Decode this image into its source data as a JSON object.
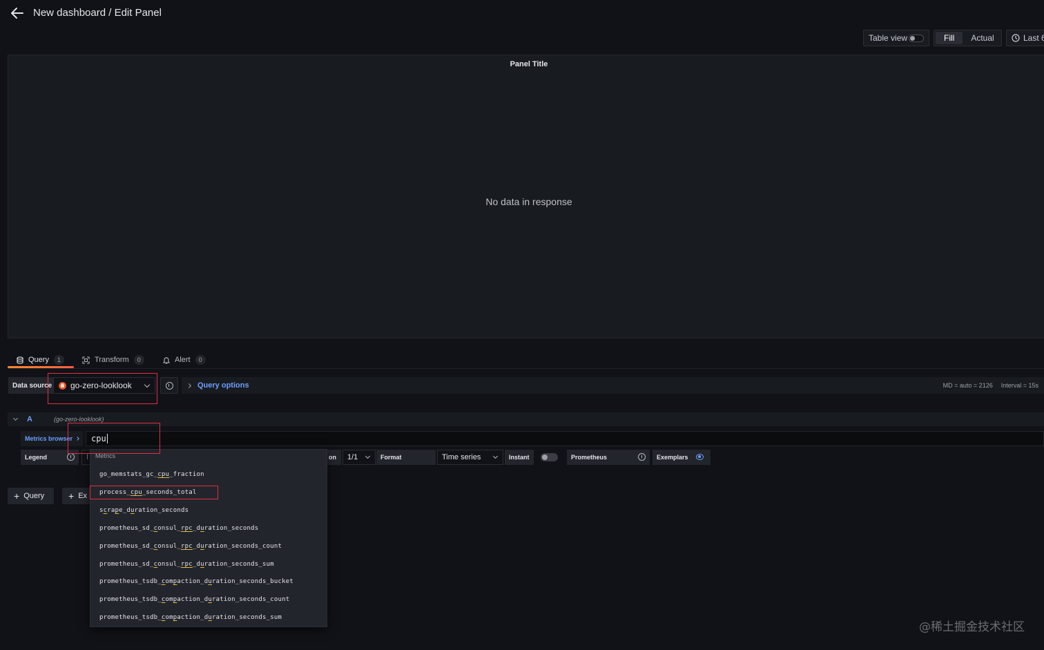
{
  "header": {
    "title": "New dashboard / Edit Panel",
    "table_view_label": "Table view",
    "fill_label": "Fill",
    "actual_label": "Actual",
    "time_range_label": "Last 6"
  },
  "panel": {
    "title": "Panel Title",
    "message": "No data in response"
  },
  "tabs": [
    {
      "label": "Query",
      "count": "1"
    },
    {
      "label": "Transform",
      "count": "0"
    },
    {
      "label": "Alert",
      "count": "0"
    }
  ],
  "datasource": {
    "label": "Data source",
    "value": "go-zero-looklook",
    "query_options_label": "Query options",
    "md_info": "MD = auto = 2126",
    "interval_info": "Interval = 15s"
  },
  "query": {
    "letter": "A",
    "datasource_hint": "(go-zero-looklook)",
    "metrics_browser_label": "Metrics browser",
    "input_value": "cpu"
  },
  "options": {
    "legend_label": "Legend",
    "legend_value_partial": "I",
    "resolution_label_partial": "on",
    "resolution_value": "1/1",
    "format_label": "Format",
    "format_value": "Time series",
    "instant_label": "Instant",
    "type_label": "Prometheus",
    "exemplars_label": "Exemplars"
  },
  "buttons": {
    "add_query": "Query",
    "add_expression_partial": "Ex"
  },
  "dropdown": {
    "header": "Metrics",
    "items": [
      {
        "parts": [
          "go_memstats_gc_",
          "cpu",
          "_fraction"
        ]
      },
      {
        "parts": [
          "process_",
          "cpu",
          "_seconds_total"
        ]
      },
      {
        "parts": [
          "s",
          "c",
          "ra",
          "p",
          "e_d",
          "u",
          "ration_seconds"
        ]
      },
      {
        "parts": [
          "prometheus_sd_",
          "c",
          "onsul_",
          "rpc",
          "_d",
          "u",
          "ration_seconds"
        ]
      },
      {
        "parts": [
          "prometheus_sd_",
          "c",
          "onsul_",
          "rpc",
          "_d",
          "u",
          "ration_seconds_count"
        ]
      },
      {
        "parts": [
          "prometheus_sd_",
          "c",
          "onsul_",
          "rpc",
          "_d",
          "u",
          "ration_seconds_sum"
        ]
      },
      {
        "parts": [
          "prometheus_tsdb_",
          "c",
          "om",
          "p",
          "action_d",
          "u",
          "ration_seconds_bucket"
        ]
      },
      {
        "parts": [
          "prometheus_tsdb_",
          "c",
          "om",
          "p",
          "action_d",
          "u",
          "ration_seconds_count"
        ]
      },
      {
        "parts": [
          "prometheus_tsdb_",
          "c",
          "om",
          "p",
          "action_d",
          "u",
          "ration_seconds_sum"
        ]
      }
    ]
  },
  "watermark": "@稀土掘金技术社区",
  "colors": {
    "accent_blue": "#6e9fff",
    "tab_active": "#ff8833",
    "annotation_red": "#e02f44",
    "match_underline": "#eab839"
  }
}
